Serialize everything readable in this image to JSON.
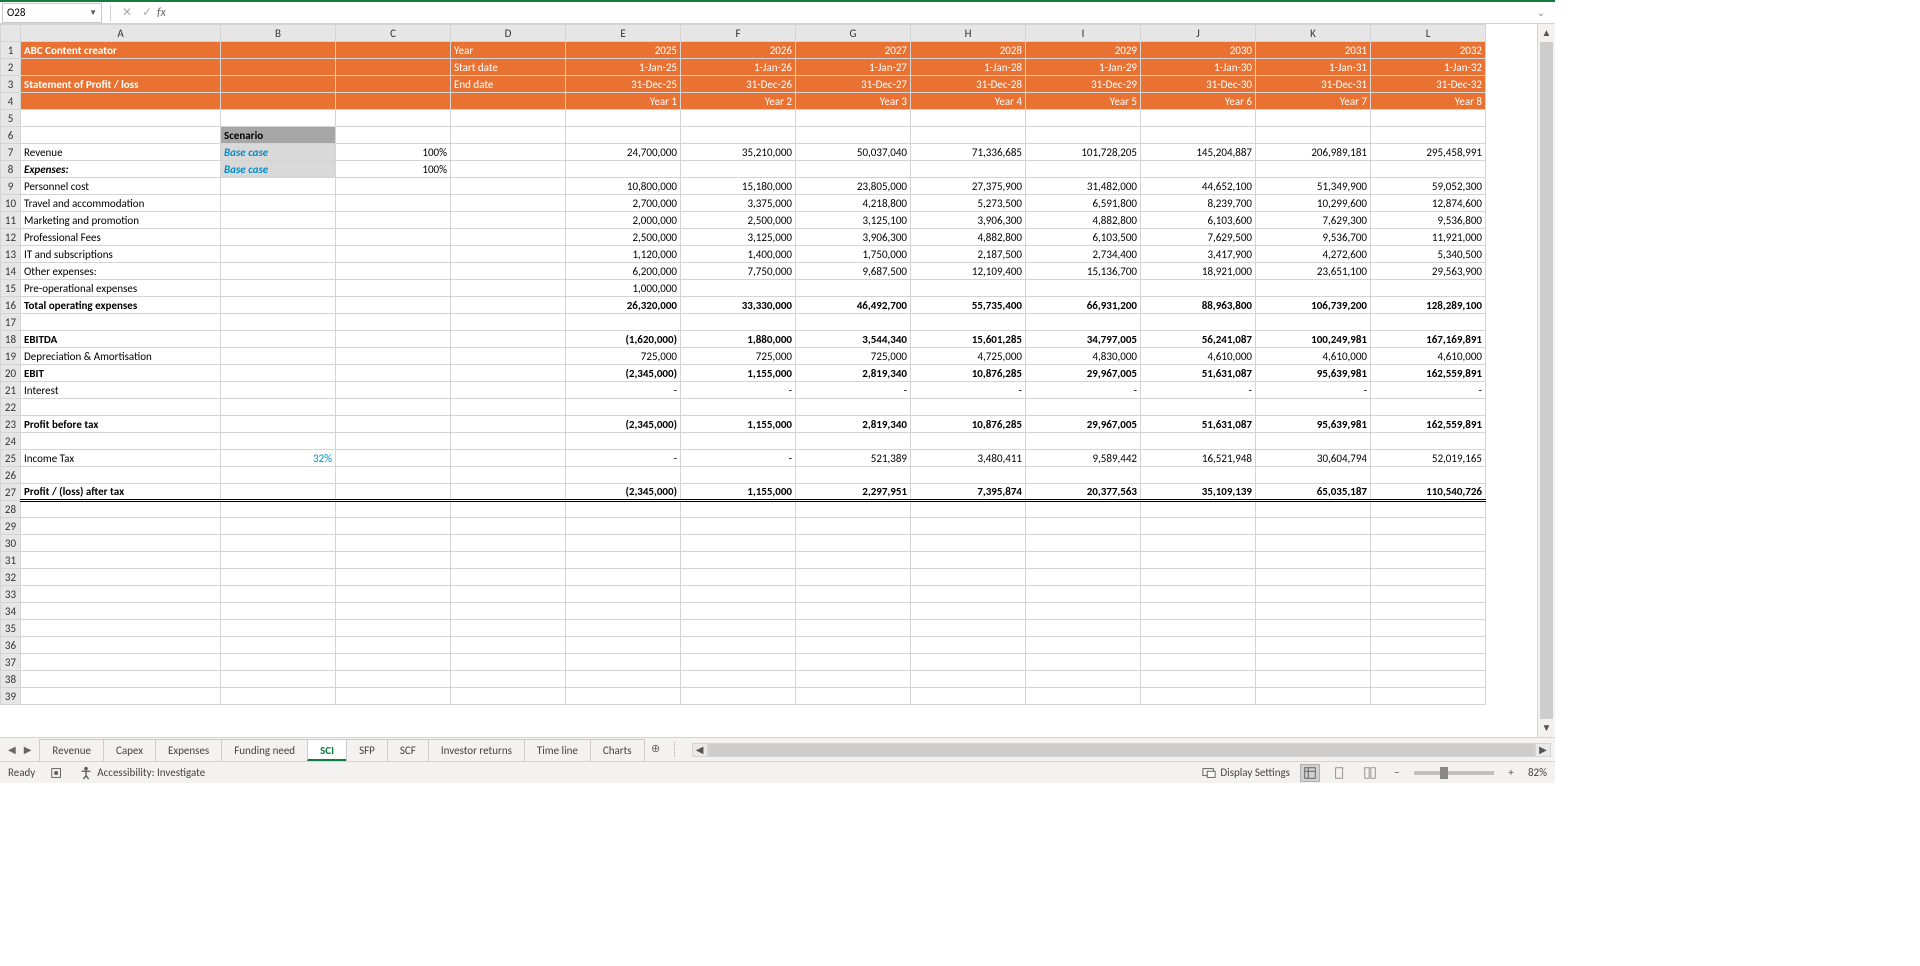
{
  "name_box": "O28",
  "formula": "",
  "columns": [
    "A",
    "B",
    "C",
    "D",
    "E",
    "F",
    "G",
    "H",
    "I",
    "J",
    "K",
    "L"
  ],
  "header": {
    "title": "ABC Content creator",
    "subtitle": "Statement of Profit / loss",
    "labels": {
      "year": "Year",
      "start": "Start date",
      "end": "End date"
    },
    "years": [
      "2025",
      "2026",
      "2027",
      "2028",
      "2029",
      "2030",
      "2031",
      "2032"
    ],
    "starts": [
      "1-Jan-25",
      "1-Jan-26",
      "1-Jan-27",
      "1-Jan-28",
      "1-Jan-29",
      "1-Jan-30",
      "1-Jan-31",
      "1-Jan-32"
    ],
    "ends": [
      "31-Dec-25",
      "31-Dec-26",
      "31-Dec-27",
      "31-Dec-28",
      "31-Dec-29",
      "31-Dec-30",
      "31-Dec-31",
      "31-Dec-32"
    ],
    "yearlbl": [
      "Year 1",
      "Year 2",
      "Year 3",
      "Year 4",
      "Year 5",
      "Year 6",
      "Year 7",
      "Year 8"
    ]
  },
  "scenario_label": "Scenario",
  "rows": {
    "revenue": {
      "label": "Revenue",
      "scenario": "Base case",
      "pct": "100%",
      "v": [
        "24,700,000",
        "35,210,000",
        "50,037,040",
        "71,336,685",
        "101,728,205",
        "145,204,887",
        "206,989,181",
        "295,458,991"
      ]
    },
    "expenses_hdr": {
      "label": "Expenses:",
      "scenario": "Base case",
      "pct": "100%"
    },
    "personnel": {
      "label": "Personnel cost",
      "v": [
        "10,800,000",
        "15,180,000",
        "23,805,000",
        "27,375,900",
        "31,482,000",
        "44,652,100",
        "51,349,900",
        "59,052,300"
      ]
    },
    "travel": {
      "label": "Travel and accommodation",
      "v": [
        "2,700,000",
        "3,375,000",
        "4,218,800",
        "5,273,500",
        "6,591,800",
        "8,239,700",
        "10,299,600",
        "12,874,600"
      ]
    },
    "marketing": {
      "label": "Marketing and promotion",
      "v": [
        "2,000,000",
        "2,500,000",
        "3,125,100",
        "3,906,300",
        "4,882,800",
        "6,103,600",
        "7,629,300",
        "9,536,800"
      ]
    },
    "prof": {
      "label": "Professional Fees",
      "v": [
        "2,500,000",
        "3,125,000",
        "3,906,300",
        "4,882,800",
        "6,103,500",
        "7,629,500",
        "9,536,700",
        "11,921,000"
      ]
    },
    "it": {
      "label": "IT and subscriptions",
      "v": [
        "1,120,000",
        "1,400,000",
        "1,750,000",
        "2,187,500",
        "2,734,400",
        "3,417,900",
        "4,272,600",
        "5,340,500"
      ]
    },
    "other": {
      "label": "Other expenses:",
      "v": [
        "6,200,000",
        "7,750,000",
        "9,687,500",
        "12,109,400",
        "15,136,700",
        "18,921,000",
        "23,651,100",
        "29,563,900"
      ]
    },
    "preop": {
      "label": "Pre-operational expenses",
      "v": [
        "1,000,000",
        "",
        "",
        "",
        "",
        "",
        "",
        ""
      ]
    },
    "totexp": {
      "label": "Total operating expenses",
      "v": [
        "26,320,000",
        "33,330,000",
        "46,492,700",
        "55,735,400",
        "66,931,200",
        "88,963,800",
        "106,739,200",
        "128,289,100"
      ]
    },
    "ebitda": {
      "label": "EBITDA",
      "v": [
        "(1,620,000)",
        "1,880,000",
        "3,544,340",
        "15,601,285",
        "34,797,005",
        "56,241,087",
        "100,249,981",
        "167,169,891"
      ]
    },
    "da": {
      "label": "Depreciation & Amortisation",
      "v": [
        "725,000",
        "725,000",
        "725,000",
        "4,725,000",
        "4,830,000",
        "4,610,000",
        "4,610,000",
        "4,610,000"
      ]
    },
    "ebit": {
      "label": "EBIT",
      "v": [
        "(2,345,000)",
        "1,155,000",
        "2,819,340",
        "10,876,285",
        "29,967,005",
        "51,631,087",
        "95,639,981",
        "162,559,891"
      ]
    },
    "interest": {
      "label": "Interest",
      "v": [
        "-",
        "-",
        "-",
        "-",
        "-",
        "-",
        "-",
        "-"
      ]
    },
    "pbt": {
      "label": "Profit before tax",
      "v": [
        "(2,345,000)",
        "1,155,000",
        "2,819,340",
        "10,876,285",
        "29,967,005",
        "51,631,087",
        "95,639,981",
        "162,559,891"
      ]
    },
    "tax": {
      "label": "Income Tax",
      "rate": "32%",
      "v": [
        "-",
        "-",
        "521,389",
        "3,480,411",
        "9,589,442",
        "16,521,948",
        "30,604,794",
        "52,019,165"
      ]
    },
    "pat": {
      "label": "Profit / (loss) after tax",
      "v": [
        "(2,345,000)",
        "1,155,000",
        "2,297,951",
        "7,395,874",
        "20,377,563",
        "35,109,139",
        "65,035,187",
        "110,540,726"
      ]
    }
  },
  "blank_rows": 12,
  "sheet_tabs": [
    "Revenue",
    "Capex",
    "Expenses",
    "Funding need",
    "SCI",
    "SFP",
    "SCF",
    "Investor returns",
    "Time line",
    "Charts"
  ],
  "active_tab": "SCI",
  "status": {
    "ready": "Ready",
    "access": "Accessibility: Investigate",
    "display": "Display Settings",
    "zoom": "82%"
  }
}
